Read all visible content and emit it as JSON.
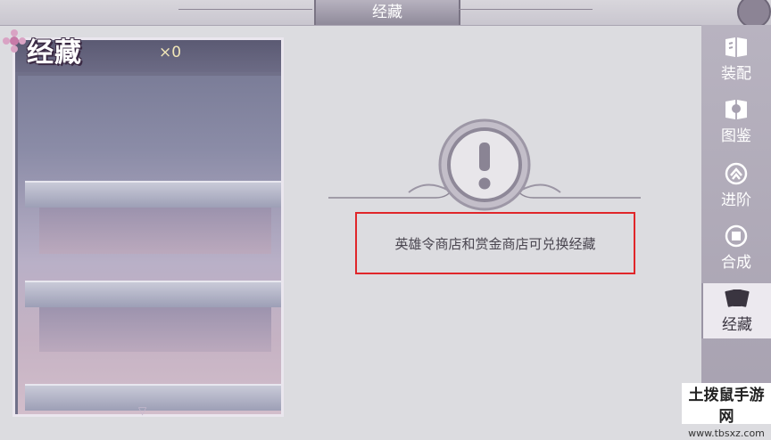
{
  "header": {
    "title": "经藏"
  },
  "left_panel": {
    "title": "经藏",
    "count": "×0"
  },
  "message": {
    "text": "英雄令商店和赏金商店可兑换经藏"
  },
  "sidebar": {
    "tabs": [
      {
        "label": "装配",
        "icon": "book-icon"
      },
      {
        "label": "图鉴",
        "icon": "codex-icon"
      },
      {
        "label": "进阶",
        "icon": "upgrade-icon"
      },
      {
        "label": "合成",
        "icon": "synthesis-icon"
      },
      {
        "label": "经藏",
        "icon": "cards-icon",
        "active": true
      }
    ]
  },
  "watermark": {
    "main": "土拨鼠手游网",
    "sub": "www.tbsxz.com"
  },
  "colors": {
    "highlight_border": "#e0262a",
    "sidebar_bg": "#aca6b5",
    "panel_border": "#eae6ee"
  }
}
